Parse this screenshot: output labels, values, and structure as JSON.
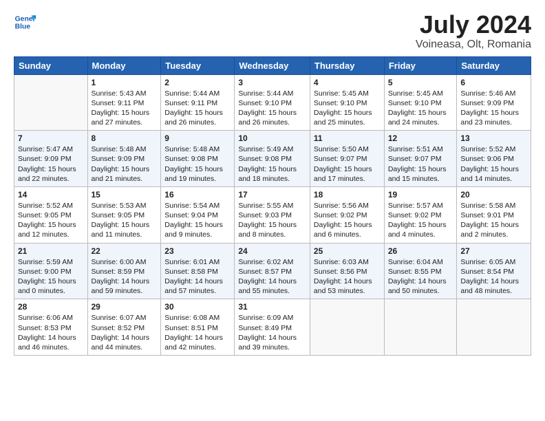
{
  "header": {
    "logo_line1": "General",
    "logo_line2": "Blue",
    "title": "July 2024",
    "subtitle": "Voineasa, Olt, Romania"
  },
  "calendar": {
    "days_of_week": [
      "Sunday",
      "Monday",
      "Tuesday",
      "Wednesday",
      "Thursday",
      "Friday",
      "Saturday"
    ],
    "weeks": [
      [
        {
          "day": "",
          "content": ""
        },
        {
          "day": "1",
          "content": "Sunrise: 5:43 AM\nSunset: 9:11 PM\nDaylight: 15 hours\nand 27 minutes."
        },
        {
          "day": "2",
          "content": "Sunrise: 5:44 AM\nSunset: 9:11 PM\nDaylight: 15 hours\nand 26 minutes."
        },
        {
          "day": "3",
          "content": "Sunrise: 5:44 AM\nSunset: 9:10 PM\nDaylight: 15 hours\nand 26 minutes."
        },
        {
          "day": "4",
          "content": "Sunrise: 5:45 AM\nSunset: 9:10 PM\nDaylight: 15 hours\nand 25 minutes."
        },
        {
          "day": "5",
          "content": "Sunrise: 5:45 AM\nSunset: 9:10 PM\nDaylight: 15 hours\nand 24 minutes."
        },
        {
          "day": "6",
          "content": "Sunrise: 5:46 AM\nSunset: 9:09 PM\nDaylight: 15 hours\nand 23 minutes."
        }
      ],
      [
        {
          "day": "7",
          "content": "Sunrise: 5:47 AM\nSunset: 9:09 PM\nDaylight: 15 hours\nand 22 minutes."
        },
        {
          "day": "8",
          "content": "Sunrise: 5:48 AM\nSunset: 9:09 PM\nDaylight: 15 hours\nand 21 minutes."
        },
        {
          "day": "9",
          "content": "Sunrise: 5:48 AM\nSunset: 9:08 PM\nDaylight: 15 hours\nand 19 minutes."
        },
        {
          "day": "10",
          "content": "Sunrise: 5:49 AM\nSunset: 9:08 PM\nDaylight: 15 hours\nand 18 minutes."
        },
        {
          "day": "11",
          "content": "Sunrise: 5:50 AM\nSunset: 9:07 PM\nDaylight: 15 hours\nand 17 minutes."
        },
        {
          "day": "12",
          "content": "Sunrise: 5:51 AM\nSunset: 9:07 PM\nDaylight: 15 hours\nand 15 minutes."
        },
        {
          "day": "13",
          "content": "Sunrise: 5:52 AM\nSunset: 9:06 PM\nDaylight: 15 hours\nand 14 minutes."
        }
      ],
      [
        {
          "day": "14",
          "content": "Sunrise: 5:52 AM\nSunset: 9:05 PM\nDaylight: 15 hours\nand 12 minutes."
        },
        {
          "day": "15",
          "content": "Sunrise: 5:53 AM\nSunset: 9:05 PM\nDaylight: 15 hours\nand 11 minutes."
        },
        {
          "day": "16",
          "content": "Sunrise: 5:54 AM\nSunset: 9:04 PM\nDaylight: 15 hours\nand 9 minutes."
        },
        {
          "day": "17",
          "content": "Sunrise: 5:55 AM\nSunset: 9:03 PM\nDaylight: 15 hours\nand 8 minutes."
        },
        {
          "day": "18",
          "content": "Sunrise: 5:56 AM\nSunset: 9:02 PM\nDaylight: 15 hours\nand 6 minutes."
        },
        {
          "day": "19",
          "content": "Sunrise: 5:57 AM\nSunset: 9:02 PM\nDaylight: 15 hours\nand 4 minutes."
        },
        {
          "day": "20",
          "content": "Sunrise: 5:58 AM\nSunset: 9:01 PM\nDaylight: 15 hours\nand 2 minutes."
        }
      ],
      [
        {
          "day": "21",
          "content": "Sunrise: 5:59 AM\nSunset: 9:00 PM\nDaylight: 15 hours\nand 0 minutes."
        },
        {
          "day": "22",
          "content": "Sunrise: 6:00 AM\nSunset: 8:59 PM\nDaylight: 14 hours\nand 59 minutes."
        },
        {
          "day": "23",
          "content": "Sunrise: 6:01 AM\nSunset: 8:58 PM\nDaylight: 14 hours\nand 57 minutes."
        },
        {
          "day": "24",
          "content": "Sunrise: 6:02 AM\nSunset: 8:57 PM\nDaylight: 14 hours\nand 55 minutes."
        },
        {
          "day": "25",
          "content": "Sunrise: 6:03 AM\nSunset: 8:56 PM\nDaylight: 14 hours\nand 53 minutes."
        },
        {
          "day": "26",
          "content": "Sunrise: 6:04 AM\nSunset: 8:55 PM\nDaylight: 14 hours\nand 50 minutes."
        },
        {
          "day": "27",
          "content": "Sunrise: 6:05 AM\nSunset: 8:54 PM\nDaylight: 14 hours\nand 48 minutes."
        }
      ],
      [
        {
          "day": "28",
          "content": "Sunrise: 6:06 AM\nSunset: 8:53 PM\nDaylight: 14 hours\nand 46 minutes."
        },
        {
          "day": "29",
          "content": "Sunrise: 6:07 AM\nSunset: 8:52 PM\nDaylight: 14 hours\nand 44 minutes."
        },
        {
          "day": "30",
          "content": "Sunrise: 6:08 AM\nSunset: 8:51 PM\nDaylight: 14 hours\nand 42 minutes."
        },
        {
          "day": "31",
          "content": "Sunrise: 6:09 AM\nSunset: 8:49 PM\nDaylight: 14 hours\nand 39 minutes."
        },
        {
          "day": "",
          "content": ""
        },
        {
          "day": "",
          "content": ""
        },
        {
          "day": "",
          "content": ""
        }
      ]
    ]
  }
}
